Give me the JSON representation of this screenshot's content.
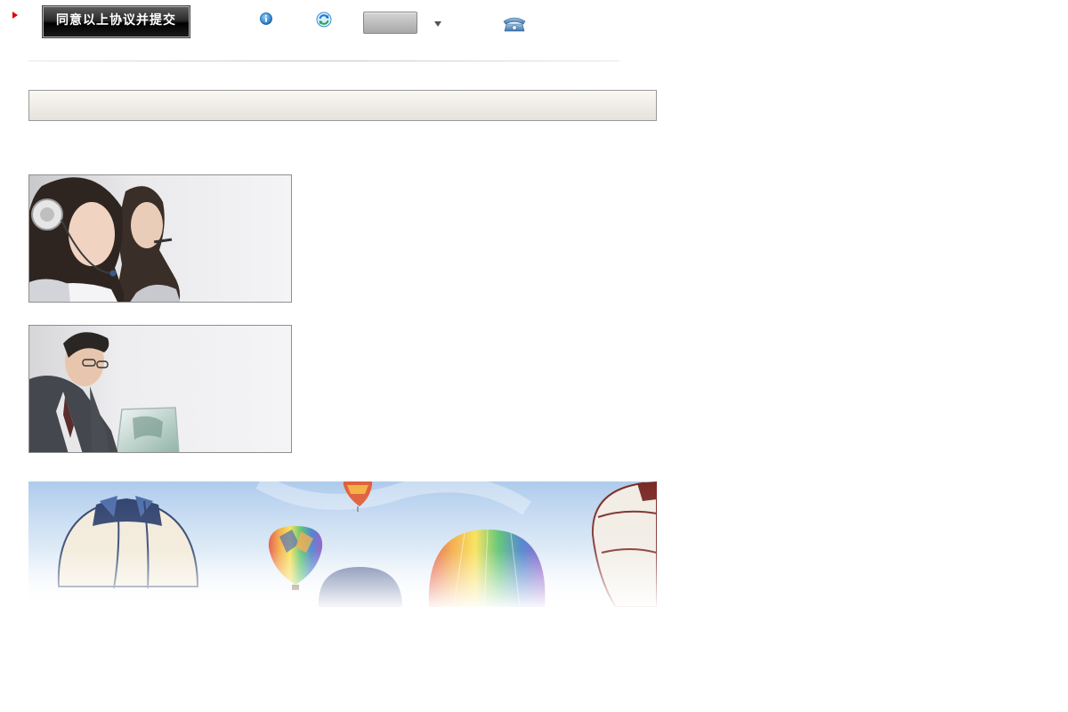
{
  "toolbar": {
    "submit_label": "同意以上协议并提交",
    "icons": [
      "play-marker-icon",
      "info-icon",
      "refresh-icon",
      "dropdown-caret-icon",
      "telephone-icon"
    ],
    "gray_button_label": ""
  },
  "panels": {
    "header_bar_text": ""
  },
  "images": [
    {
      "name": "customer-service-agents-photo"
    },
    {
      "name": "businessman-laptop-photo"
    },
    {
      "name": "hot-air-balloons-banner"
    }
  ],
  "colors": {
    "marker_red": "#e00000",
    "button_black": "#111111",
    "icon_blue": "#1f78c8",
    "header_bar_bg": "#efede6",
    "divider_gray": "#c4c4c4",
    "sky_blue": "#b7d3ee"
  }
}
